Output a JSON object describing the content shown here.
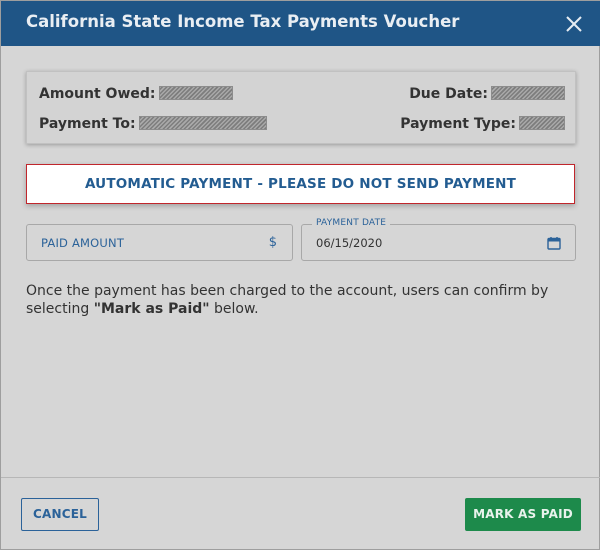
{
  "dialog": {
    "title": "California State Income Tax Payments Voucher",
    "close_icon": "close-icon"
  },
  "info": {
    "amount_owed_label": "Amount Owed:",
    "due_date_label": "Due Date:",
    "payment_to_label": "Payment To:",
    "payment_type_label": "Payment Type:"
  },
  "banner": {
    "text": "AUTOMATIC PAYMENT - PLEASE DO NOT SEND PAYMENT",
    "border_color": "#c0262c"
  },
  "form": {
    "paid_amount_label": "PAID AMOUNT",
    "currency_symbol": "$",
    "payment_date_label": "PAYMENT DATE",
    "payment_date_value": "06/15/2020",
    "calendar_icon": "calendar-icon"
  },
  "note": {
    "text_before": "Once the payment has been charged to the account, users can confirm by selecting ",
    "emphasis": "\"Mark as Paid\"",
    "text_after": " below."
  },
  "footer": {
    "cancel_label": "CANCEL",
    "mark_paid_label": "MARK AS PAID"
  },
  "colors": {
    "header_bg": "#1f5586",
    "accent_blue": "#2b6299",
    "success_green": "#1d8a4b"
  }
}
